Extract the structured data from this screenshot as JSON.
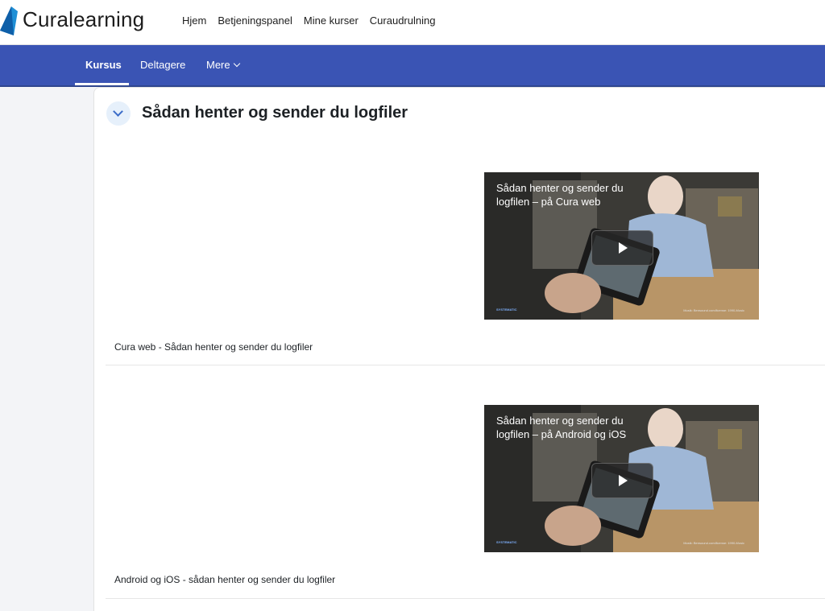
{
  "brand": {
    "name": "Curalearning",
    "logo_icon": "curalearning-logo-icon",
    "logo_color": "#1f8fd6"
  },
  "topnav": [
    "Hjem",
    "Betjeningspanel",
    "Mine kurser",
    "Curaudrulning"
  ],
  "secondary_nav": {
    "items": [
      "Kursus",
      "Deltagere",
      "Mere"
    ],
    "active": "Kursus",
    "more_icon": "chevron-down-icon",
    "background": "#3a54b4"
  },
  "section": {
    "title": "Sådan henter og sender du logfiler",
    "toggle_icon": "chevron-down-icon",
    "activities": [
      {
        "video_title": "Sådan henter og sender du logfilen – på Cura web",
        "video_logo": "SYSTEMATIC",
        "video_caption": "Musik: Bensound.com/license: 1990-Music",
        "label": "Cura web - Sådan henter og sender du logfiler"
      },
      {
        "video_title": "Sådan henter og sender du logfilen – på Android og iOS",
        "video_logo": "SYSTEMATIC",
        "video_caption": "Musik: Bensound.com/license: 1990-Music",
        "label": "Android og iOS - sådan henter og sender du logfiler"
      }
    ]
  }
}
